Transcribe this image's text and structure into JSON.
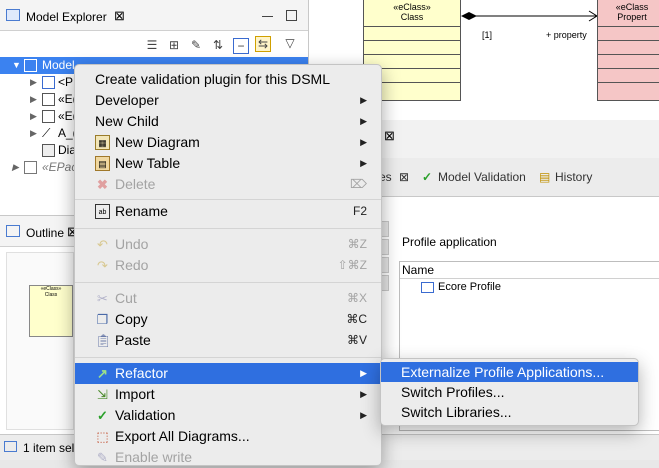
{
  "model_explorer": {
    "title": "Model Explorer",
    "tree": [
      {
        "label": "Model",
        "selected": true
      },
      {
        "label": "<P"
      },
      {
        "label": "«E("
      },
      {
        "label": "«E("
      },
      {
        "label": "A_("
      },
      {
        "label": "Dia"
      },
      {
        "label": "«EPac"
      }
    ]
  },
  "diagram": {
    "left_class": {
      "stereotype": "«eClass»",
      "name": "Class"
    },
    "right_class": {
      "stereotype": "«eClass",
      "name": "Propert"
    },
    "multiplicity": "[1]",
    "role": "+ property"
  },
  "properties_tabs": {
    "tabs": [
      "es",
      "Model Validation",
      "History"
    ]
  },
  "properties_panel": {
    "section_title": "Profile application",
    "column_header": "Name",
    "rows": [
      "Ecore Profile"
    ]
  },
  "outline": {
    "title": "Outline",
    "thumb_stereotype": "«eClass»",
    "thumb_name": "Class"
  },
  "status": {
    "text": "1 item sel"
  },
  "context_menu": {
    "items": [
      {
        "label": "Create validation plugin for this DSML",
        "noicon": true
      },
      {
        "label": "Developer",
        "noicon": true,
        "submenu": true
      },
      {
        "label": "New Child",
        "noicon": true,
        "submenu": true
      },
      {
        "label": "New Diagram",
        "icon": "new-diagram-icon",
        "submenu": true
      },
      {
        "label": "New Table",
        "icon": "new-table-icon",
        "submenu": true
      },
      {
        "label": "Delete",
        "icon": "delete-icon",
        "disabled": true
      },
      {
        "label": "Rename",
        "icon": "rename-icon",
        "shortcut": "F2"
      },
      {
        "label": "Undo",
        "icon": "undo-icon",
        "shortcut": "⌘Z",
        "disabled": true
      },
      {
        "label": "Redo",
        "icon": "redo-icon",
        "shortcut": "⇧⌘Z",
        "disabled": true
      },
      {
        "label": "Cut",
        "icon": "cut-icon",
        "shortcut": "⌘X",
        "disabled": true
      },
      {
        "label": "Copy",
        "icon": "copy-icon",
        "shortcut": "⌘C"
      },
      {
        "label": "Paste",
        "icon": "paste-icon",
        "shortcut": "⌘V"
      },
      {
        "label": "Refactor",
        "icon": "refactor-icon",
        "submenu": true,
        "highlighted": true
      },
      {
        "label": "Import",
        "icon": "import-icon",
        "submenu": true
      },
      {
        "label": "Validation",
        "icon": "validation-icon",
        "submenu": true
      },
      {
        "label": "Export All Diagrams...",
        "icon": "export-icon"
      },
      {
        "label": "Enable write",
        "icon": "enable-write-icon",
        "disabled": true
      }
    ]
  },
  "refactor_submenu": {
    "items": [
      {
        "label": "Externalize Profile Applications...",
        "highlighted": true
      },
      {
        "label": "Switch Profiles..."
      },
      {
        "label": "Switch Libraries..."
      }
    ]
  },
  "colors": {
    "selection": "#3b82f0",
    "menu_highlight": "#2f6fe0",
    "class_yellow": "#ffffcc",
    "class_pink": "#f5c6c6"
  }
}
